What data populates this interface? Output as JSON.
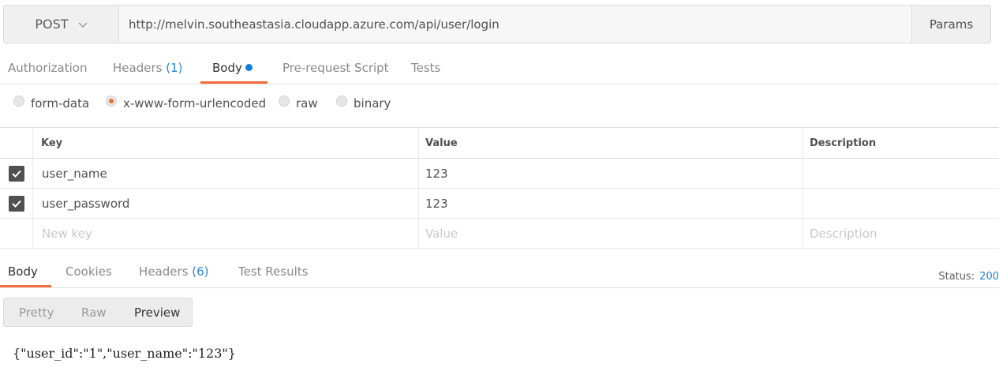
{
  "request": {
    "method": "POST",
    "url": "http://melvin.southeastasia.cloudapp.azure.com/api/user/login",
    "params_label": "Params"
  },
  "request_tabs": [
    {
      "label": "Authorization"
    },
    {
      "label": "Headers",
      "count": "(1)"
    },
    {
      "label": "Body",
      "active": true
    },
    {
      "label": "Pre-request Script"
    },
    {
      "label": "Tests"
    }
  ],
  "body_types": [
    {
      "label": "form-data",
      "selected": false
    },
    {
      "label": "x-www-form-urlencoded",
      "selected": true
    },
    {
      "label": "raw",
      "selected": false
    },
    {
      "label": "binary",
      "selected": false
    }
  ],
  "kv_table": {
    "headers": {
      "key": "Key",
      "value": "Value",
      "description": "Description"
    },
    "rows": [
      {
        "checked": true,
        "key": "user_name",
        "value": "123",
        "description": ""
      },
      {
        "checked": true,
        "key": "user_password",
        "value": "123",
        "description": ""
      }
    ],
    "placeholders": {
      "key": "New key",
      "value": "Value",
      "description": "Description"
    }
  },
  "response_tabs": [
    {
      "label": "Body",
      "active": true
    },
    {
      "label": "Cookies"
    },
    {
      "label": "Headers",
      "count": "(6)"
    },
    {
      "label": "Test Results"
    }
  ],
  "status": {
    "label": "Status:",
    "code": "200"
  },
  "view_modes": [
    {
      "label": "Pretty"
    },
    {
      "label": "Raw"
    },
    {
      "label": "Preview",
      "active": true
    }
  ],
  "response_body": "{\"user_id\":\"1\",\"user_name\":\"123\"}",
  "colors": {
    "accent": "#f26b3a",
    "link": "#2a85d6",
    "body_dot": "#0d7fe0"
  }
}
